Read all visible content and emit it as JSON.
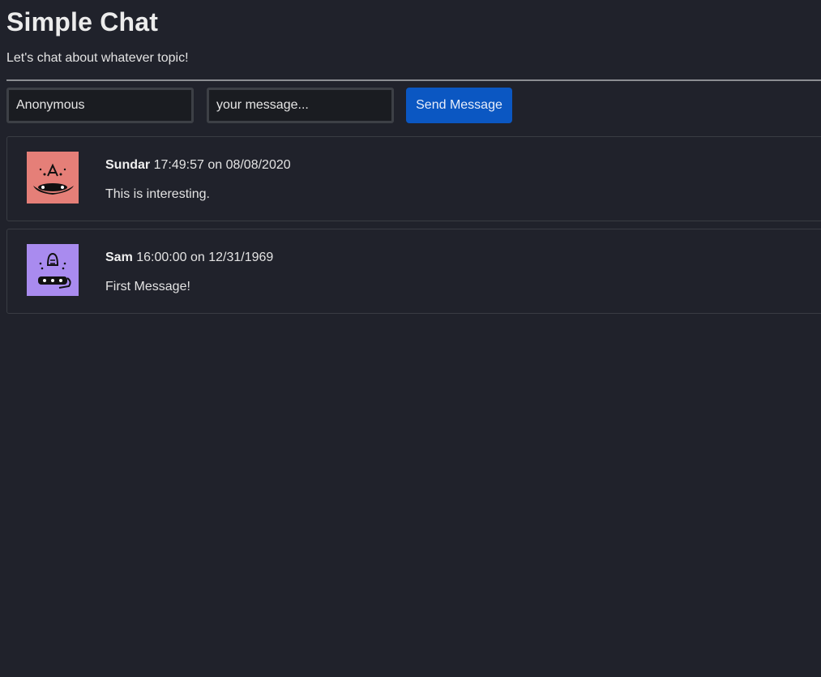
{
  "header": {
    "title": "Simple Chat",
    "subtitle": "Let's chat about whatever topic!"
  },
  "form": {
    "name_value": "Anonymous",
    "message_placeholder": "your message...",
    "send_label": "Send Message"
  },
  "messages": [
    {
      "author": "Sundar",
      "time": "17:49:57",
      "on": "on",
      "date": "08/08/2020",
      "text": "This is interesting.",
      "avatar_color": "#e57f78",
      "avatar_icon": "monster-avatar-icon"
    },
    {
      "author": "Sam",
      "time": "16:00:00",
      "on": "on",
      "date": "12/31/1969",
      "text": "First Message!",
      "avatar_color": "#a98bef",
      "avatar_icon": "monster-avatar-icon"
    }
  ],
  "colors": {
    "background": "#20222b",
    "button": "#0b57c2"
  }
}
